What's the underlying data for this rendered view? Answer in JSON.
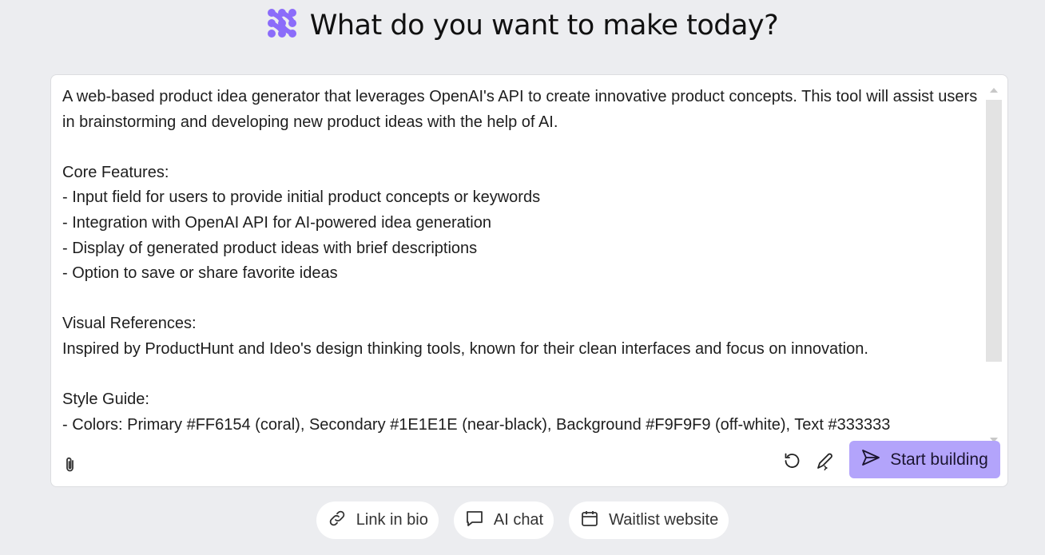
{
  "header": {
    "title": "What do you want to make today?",
    "logo_icon": "dots-logo-icon",
    "accent": "#8B6CFA"
  },
  "prompt": {
    "value": "A web-based product idea generator that leverages OpenAI's API to create innovative product concepts. This tool will assist users in brainstorming and developing new product ideas with the help of AI.\n\nCore Features:\n- Input field for users to provide initial product concepts or keywords\n- Integration with OpenAI API for AI-powered idea generation\n- Display of generated product ideas with brief descriptions\n- Option to save or share favorite ideas\n\nVisual References:\nInspired by ProductHunt and Ideo's design thinking tools, known for their clean interfaces and focus on innovation.\n\nStyle Guide:\n- Colors: Primary #FF6154 (coral), Secondary #1E1E1E (near-black), Background #F9F9F9 (off-white), Text #333333"
  },
  "toolbar": {
    "attach_icon": "paperclip-icon",
    "reset_icon": "undo-icon",
    "enhance_icon": "pen-sparkle-icon",
    "start_label": "Start building",
    "start_icon": "send-icon",
    "start_color": "#B3A4FB"
  },
  "suggestions": [
    {
      "label": "Link in bio",
      "icon": "link-icon"
    },
    {
      "label": "AI chat",
      "icon": "chat-bubble-icon"
    },
    {
      "label": "Waitlist website",
      "icon": "calendar-icon"
    }
  ]
}
